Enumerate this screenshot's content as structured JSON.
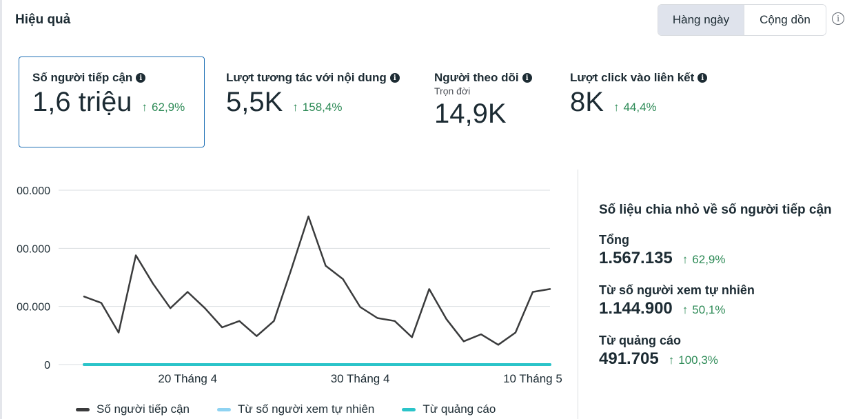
{
  "header": {
    "title": "Hiệu quả",
    "toggle_daily": "Hàng ngày",
    "toggle_cumulative": "Cộng dồn",
    "info_icon": "i"
  },
  "metrics": [
    {
      "label": "Số người tiếp cận",
      "value": "1,6 triệu",
      "change": "62,9%",
      "sub": ""
    },
    {
      "label": "Lượt tương tác với nội dung",
      "value": "5,5K",
      "change": "158,4%",
      "sub": ""
    },
    {
      "label": "Người theo dõi",
      "value": "14,9K",
      "change": "",
      "sub": "Trọn đời"
    },
    {
      "label": "Lượt click vào liên kết",
      "value": "8K",
      "change": "44,4%",
      "sub": ""
    }
  ],
  "colors": {
    "accent": "#1e6fb5",
    "positive": "#2e8b57",
    "series_main": "#3a3b3c",
    "series_organic": "#8fd3f2",
    "series_ads": "#2bc4c9"
  },
  "chart_data": {
    "type": "line",
    "title": "",
    "xlabel": "",
    "ylabel": "",
    "y_tick_labels": [
      "0",
      "00.000",
      "00.000",
      "00.000"
    ],
    "x_tick_labels": [
      "20 Tháng 4",
      "30 Tháng 4",
      "10 Tháng 5"
    ],
    "ylim": [
      0,
      3
    ],
    "x": [
      "14 Tháng 4",
      "15 Tháng 4",
      "16 Tháng 4",
      "17 Tháng 4",
      "18 Tháng 4",
      "19 Tháng 4",
      "20 Tháng 4",
      "21 Tháng 4",
      "22 Tháng 4",
      "23 Tháng 4",
      "24 Tháng 4",
      "25 Tháng 4",
      "26 Tháng 4",
      "27 Tháng 4",
      "28 Tháng 4",
      "29 Tháng 4",
      "30 Tháng 4",
      "1 Tháng 5",
      "2 Tháng 5",
      "3 Tháng 5",
      "4 Tháng 5",
      "5 Tháng 5",
      "6 Tháng 5",
      "7 Tháng 5",
      "8 Tháng 5",
      "9 Tháng 5",
      "10 Tháng 5",
      "11 Tháng 5"
    ],
    "x_tick_index": [
      6,
      16,
      26
    ],
    "series": [
      {
        "name": "Số người tiếp cận",
        "color": "#3a3b3c",
        "values": [
          1.17,
          1.06,
          0.55,
          1.88,
          1.39,
          0.97,
          1.25,
          0.97,
          0.64,
          0.75,
          0.49,
          0.75,
          1.63,
          2.55,
          1.7,
          1.47,
          0.99,
          0.8,
          0.75,
          0.47,
          1.3,
          0.78,
          0.4,
          0.52,
          0.34,
          0.55,
          1.25,
          1.3
        ]
      },
      {
        "name": "Từ số người xem tự nhiên",
        "color": "#8fd3f2",
        "values": [
          0,
          0,
          0,
          0,
          0,
          0,
          0,
          0,
          0,
          0,
          0,
          0,
          0,
          0,
          0,
          0,
          0,
          0,
          0,
          0,
          0,
          0,
          0,
          0,
          0,
          0,
          0,
          0
        ]
      },
      {
        "name": "Từ quảng cáo",
        "color": "#2bc4c9",
        "values": [
          0,
          0,
          0,
          0,
          0,
          0,
          0,
          0,
          0,
          0,
          0,
          0,
          0,
          0,
          0,
          0,
          0,
          0,
          0,
          0,
          0,
          0,
          0,
          0,
          0,
          0,
          0,
          0
        ]
      }
    ],
    "grid": true,
    "legend_position": "bottom-left"
  },
  "breakdown": {
    "title": "Số liệu chia nhỏ về số người tiếp cận",
    "items": [
      {
        "label": "Tổng",
        "value": "1.567.135",
        "change": "62,9%"
      },
      {
        "label": "Từ số người xem tự nhiên",
        "value": "1.144.900",
        "change": "50,1%"
      },
      {
        "label": "Từ quảng cáo",
        "value": "491.705",
        "change": "100,3%"
      }
    ]
  }
}
